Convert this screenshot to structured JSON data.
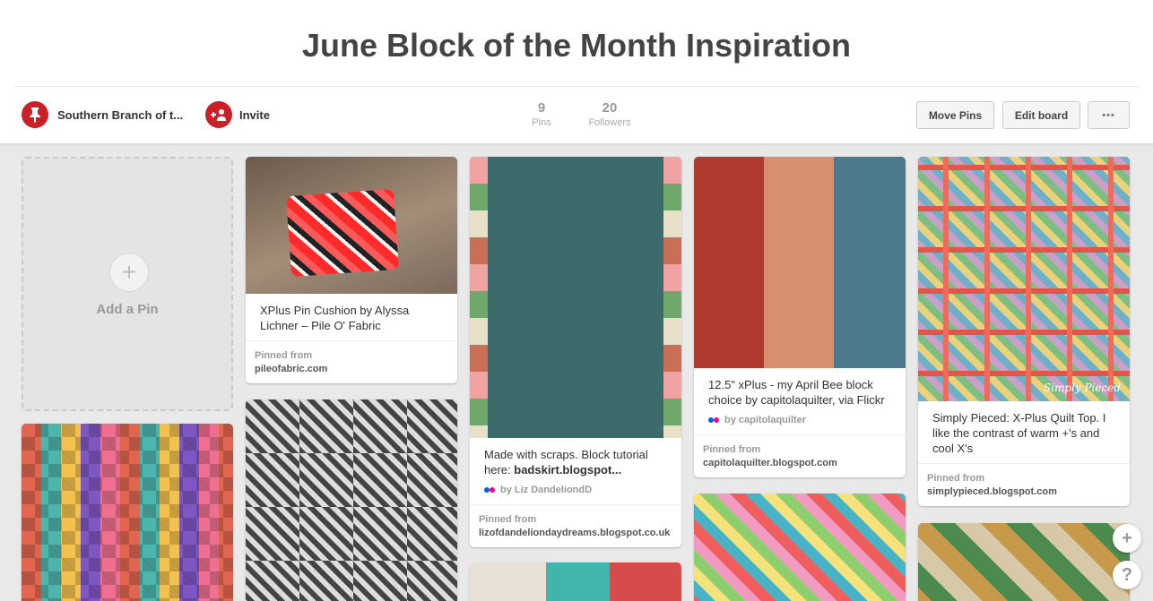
{
  "board": {
    "title": "June Block of the Month Inspiration",
    "owner": "Southern Branch of t...",
    "invite_label": "Invite"
  },
  "stats": {
    "pins_count": "9",
    "pins_label": "Pins",
    "followers_count": "20",
    "followers_label": "Followers"
  },
  "actions": {
    "move_pins": "Move Pins",
    "edit_board": "Edit board",
    "more": "•••"
  },
  "add_pin": {
    "label": "Add a Pin",
    "icon": "+"
  },
  "pins": [
    {
      "description": "XPlus Pin Cushion by Alyssa Lichner – Pile O' Fabric",
      "pinned_from_label": "Pinned from",
      "source": "pileofabric.com"
    },
    {
      "description_prefix": "Made with scraps. Block tutorial here: ",
      "description_link": "badskirt.blogspot...",
      "via": "by Liz DandeliondD",
      "pinned_from_label": "Pinned from",
      "source": "lizofdandeliondaydreams.blogspot.co.uk"
    },
    {
      "description": "12.5\" xPlus - my April Bee block choice by capitolaquilter, via Flickr",
      "via": "by capitolaquilter",
      "pinned_from_label": "Pinned from",
      "source": "capitolaquilter.blogspot.com"
    },
    {
      "description": "Simply Pieced: X-Plus Quilt Top. I like the contrast of warm +'s and cool X's",
      "pinned_from_label": "Pinned from",
      "source": "simplypieced.blogspot.com",
      "watermark": "Simply Pieced"
    }
  ],
  "floating": {
    "add_icon": "+",
    "help_icon": "?"
  },
  "colors": {
    "brand_red": "#cb2027",
    "flickr_blue": "#0063dc",
    "flickr_pink": "#ff0084"
  }
}
